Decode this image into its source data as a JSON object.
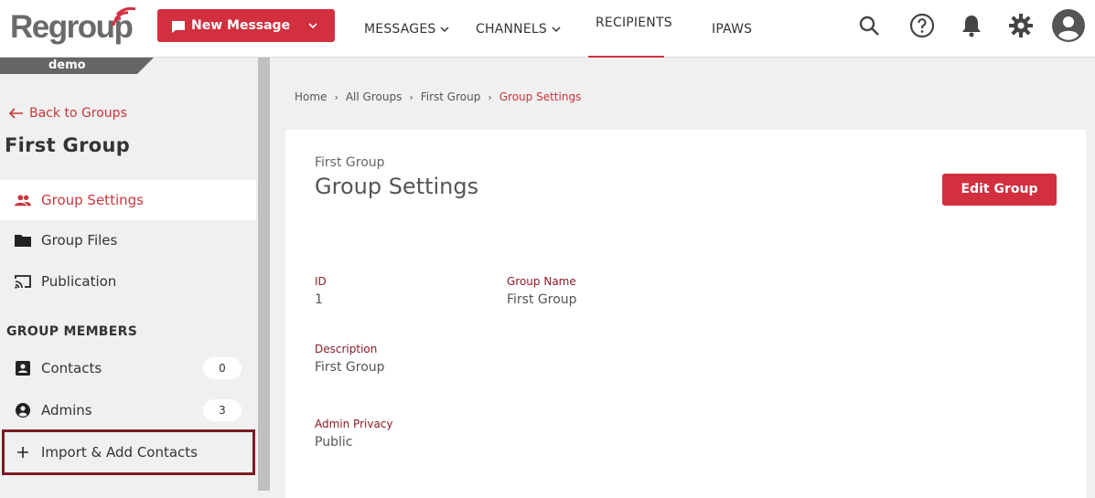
{
  "app": {
    "logo_text": "Regroup"
  },
  "toolbar": {
    "new_message_label": "New Message",
    "nav": [
      {
        "label": "MESSAGES",
        "has_dropdown": true
      },
      {
        "label": "CHANNELS",
        "has_dropdown": true
      },
      {
        "label": "RECIPIENTS",
        "has_dropdown": true,
        "active": true
      },
      {
        "label": "IPAWS",
        "has_dropdown": false
      }
    ],
    "icons": [
      "search-icon",
      "help-icon",
      "bell-icon",
      "gear-icon",
      "account-icon"
    ]
  },
  "sidebar": {
    "account_tag": "demo",
    "back_label": "Back to Groups",
    "group_title": "First Group",
    "items": [
      {
        "label": "Group Settings",
        "icon": "people-icon",
        "active": true
      },
      {
        "label": "Group Files",
        "icon": "folder-icon"
      },
      {
        "label": "Publication",
        "icon": "cast-icon"
      }
    ],
    "members_header": "GROUP MEMBERS",
    "members": [
      {
        "label": "Contacts",
        "icon": "contact-card-icon",
        "count": "0"
      },
      {
        "label": "Admins",
        "icon": "admin-icon",
        "count": "3"
      }
    ],
    "import_label": "Import & Add Contacts"
  },
  "breadcrumb": [
    "Home",
    "All Groups",
    "First Group",
    "Group Settings"
  ],
  "main": {
    "subtitle": "First Group",
    "title": "Group Settings",
    "edit_label": "Edit Group",
    "fields": {
      "id": {
        "label": "ID",
        "value": "1"
      },
      "name": {
        "label": "Group Name",
        "value": "First Group"
      },
      "description": {
        "label": "Description",
        "value": "First Group"
      },
      "privacy": {
        "label": "Admin Privacy",
        "value": "Public"
      }
    }
  },
  "colors": {
    "accent": "#d22f3f",
    "text_accent": "#c9353d",
    "label_dark_red": "#8a1b25",
    "focus_outline": "#7a1b24"
  }
}
